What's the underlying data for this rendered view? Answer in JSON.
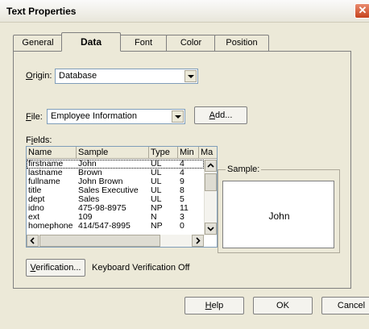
{
  "window": {
    "title": "Text Properties"
  },
  "tabs": [
    "General",
    "Data",
    "Font",
    "Color",
    "Position"
  ],
  "origin": {
    "label": "Origin:",
    "value": "Database"
  },
  "file": {
    "label": "File:",
    "value": "Employee Information",
    "add_button": "Add..."
  },
  "fields": {
    "label": "Fields:",
    "columns": [
      "Name",
      "Sample",
      "Type",
      "Min",
      "Ma"
    ],
    "rows": [
      [
        "firstname",
        "John",
        "UL",
        "4"
      ],
      [
        "lastname",
        "Brown",
        "UL",
        "4"
      ],
      [
        "fullname",
        "John Brown",
        "UL",
        "9"
      ],
      [
        "title",
        "Sales Executive",
        "UL",
        "8"
      ],
      [
        "dept",
        "Sales",
        "UL",
        "5"
      ],
      [
        "idno",
        "475-98-8975",
        "NP",
        "11"
      ],
      [
        "ext",
        "109",
        "N",
        "3"
      ],
      [
        "homephone",
        "414/547-8995",
        "NP",
        "0"
      ]
    ],
    "selected_row": "firstname"
  },
  "sample": {
    "label": "Sample:",
    "value": "John"
  },
  "verification": {
    "button": "Verification...",
    "status": "Keyboard Verification Off"
  },
  "buttons": {
    "help": "Help",
    "ok": "OK",
    "cancel": "Cancel"
  },
  "colors": {
    "window_bg": "#ece9d8",
    "close_button": "#d75a35",
    "field_border": "#7f9db9"
  }
}
